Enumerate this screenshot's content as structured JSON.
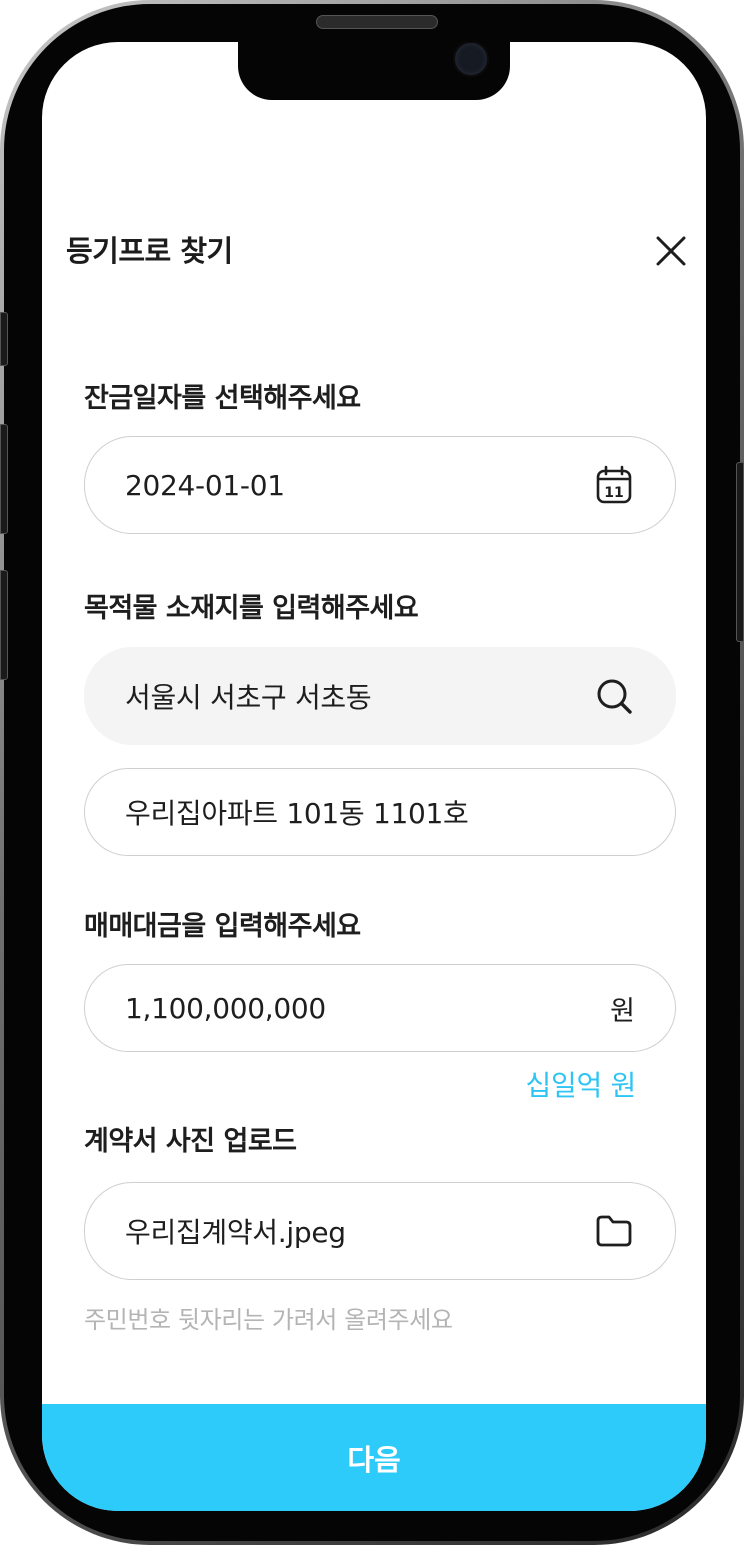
{
  "sheet": {
    "title": "등기프로 찾기"
  },
  "balance_date": {
    "label": "잔금일자를 선택해주세요",
    "value": "2024-01-01",
    "calendar_day": "11"
  },
  "location": {
    "label": "목적물 소재지를 입력해주세요",
    "address_value": "서울시 서초구 서초동",
    "detail_value": "우리집아파트 101동 1101호"
  },
  "price": {
    "label": "매매대금을 입력해주세요",
    "value": "1,100,000,000",
    "unit": "원",
    "korean_amount": "십일억 원"
  },
  "contract": {
    "label": "계약서 사진 업로드",
    "file_name": "우리집계약서.jpeg",
    "hint": "주민번호 뒷자리는 가려서 올려주세요"
  },
  "footer": {
    "next_label": "다음"
  },
  "colors": {
    "accent": "#2dcbfa",
    "accent_text": "#2ec5f4"
  }
}
